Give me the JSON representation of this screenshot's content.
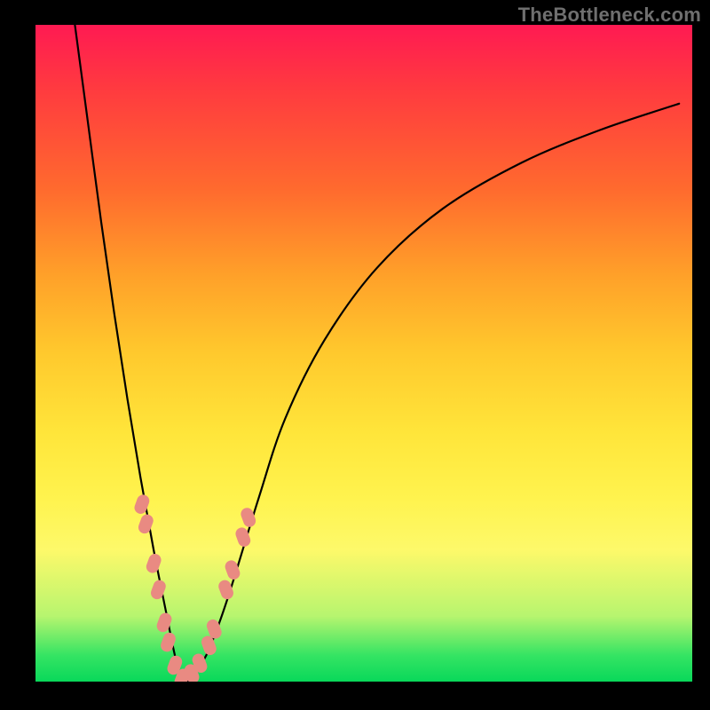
{
  "watermark": "TheBottleneck.com",
  "chart_data": {
    "type": "line",
    "title": "",
    "xlabel": "",
    "ylabel": "",
    "xlim": [
      0,
      100
    ],
    "ylim": [
      0,
      100
    ],
    "note": "Axes are unlabeled in the original image; x and y are normalized 0–100. The curve is a bottleneck V-shape with its minimum near x≈22 reaching y≈0, rising steeply to the left toward y≈100 and asymptotically toward ~y≈88 on the right.",
    "series": [
      {
        "name": "bottleneck-curve",
        "x": [
          6,
          8,
          10,
          12,
          14,
          16,
          18,
          20,
          21,
          22,
          23,
          24,
          26,
          28,
          30,
          34,
          38,
          44,
          52,
          62,
          74,
          86,
          98
        ],
        "y": [
          100,
          85,
          70,
          56,
          43,
          31,
          20,
          10,
          5,
          1,
          0,
          1,
          4,
          9,
          15,
          28,
          40,
          52,
          63,
          72,
          79,
          84,
          88
        ]
      }
    ],
    "markers": {
      "name": "highlight-beads",
      "note": "Salmon-colored rounded markers clustered near the valley on both branches.",
      "points": [
        {
          "x": 16.2,
          "y": 27
        },
        {
          "x": 16.8,
          "y": 24
        },
        {
          "x": 18.0,
          "y": 18
        },
        {
          "x": 18.7,
          "y": 14
        },
        {
          "x": 19.6,
          "y": 9
        },
        {
          "x": 20.2,
          "y": 6
        },
        {
          "x": 21.2,
          "y": 2.5
        },
        {
          "x": 22.3,
          "y": 0.5
        },
        {
          "x": 23.8,
          "y": 1.2
        },
        {
          "x": 25.0,
          "y": 2.8
        },
        {
          "x": 26.4,
          "y": 5.5
        },
        {
          "x": 27.2,
          "y": 8
        },
        {
          "x": 29.0,
          "y": 14
        },
        {
          "x": 30.0,
          "y": 17
        },
        {
          "x": 31.6,
          "y": 22
        },
        {
          "x": 32.4,
          "y": 25
        }
      ]
    },
    "colors": {
      "curve": "#000000",
      "markers": "#e98a82",
      "gradient_top": "#ff1a52",
      "gradient_bottom": "#09d85a",
      "frame": "#000000"
    }
  }
}
